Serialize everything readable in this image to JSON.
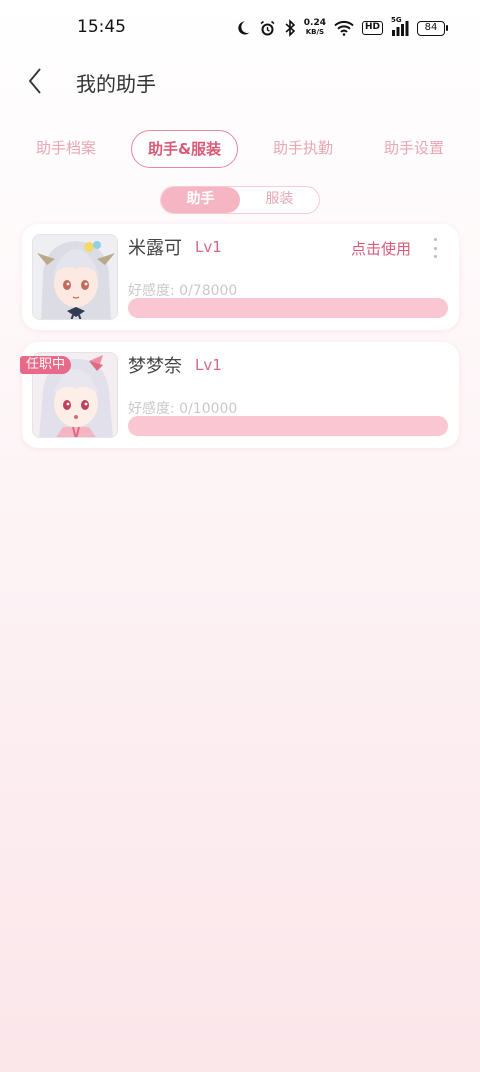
{
  "status_bar": {
    "time": "15:45",
    "speed_value": "0.24",
    "speed_unit": "KB/S",
    "hd_label": "HD",
    "network": "5G",
    "battery": "84",
    "icons": [
      "moon-icon",
      "alarm-icon",
      "bluetooth-icon",
      "wifi-icon",
      "signal-icon"
    ]
  },
  "header": {
    "title": "我的助手",
    "back_icon": "chevron-left-icon"
  },
  "top_tabs": {
    "items": [
      {
        "label": "助手档案",
        "active": false
      },
      {
        "label": "助手&服装",
        "active": true
      },
      {
        "label": "助手执勤",
        "active": false
      },
      {
        "label": "助手设置",
        "active": false
      }
    ]
  },
  "segment": {
    "items": [
      {
        "label": "助手",
        "active": true
      },
      {
        "label": "服装",
        "active": false
      }
    ]
  },
  "assistants": [
    {
      "name": "米露可",
      "level": "Lv1",
      "action": "点击使用",
      "affinity_label": "好感度: 0/78000",
      "affinity_progress": 0,
      "badge": ""
    },
    {
      "name": "梦梦奈",
      "level": "Lv1",
      "action": "",
      "affinity_label": "好感度: 0/10000",
      "affinity_progress": 0,
      "badge": "任职中"
    }
  ],
  "colors": {
    "accent": "#d85a78",
    "progress_track": "#f9c6d1",
    "badge": "#e86a88"
  }
}
